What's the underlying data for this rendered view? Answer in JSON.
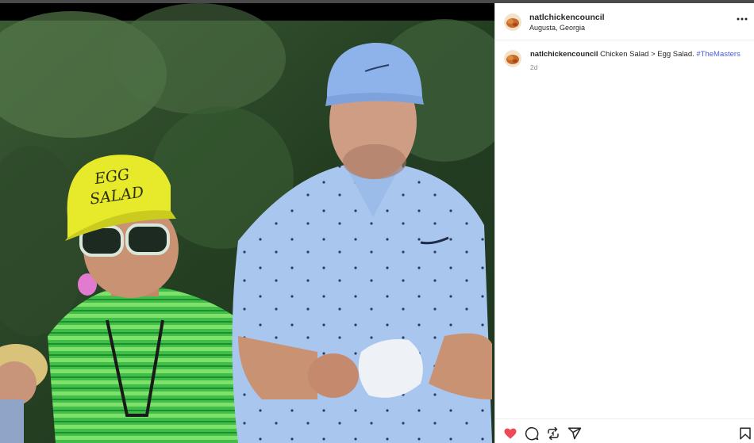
{
  "post": {
    "username": "natlchickencouncil",
    "location": "Augusta, Georgia"
  },
  "media": {
    "cap_text_line1": "EGG",
    "cap_text_line2": "SALAD"
  },
  "caption": {
    "username": "natlchickencouncil",
    "text": "Chicken Salad > Egg Salad.",
    "hashtag": "#TheMasters",
    "time": "2d"
  },
  "icons": {
    "more": "more-options-icon",
    "like": "heart-icon",
    "comment": "comment-icon",
    "repost": "repost-icon",
    "share": "send-icon",
    "save": "bookmark-icon"
  },
  "colors": {
    "like_active": "#ed4956",
    "hashtag": "#4a5fd6",
    "text": "#262626",
    "muted": "#8e8e8e"
  },
  "state": {
    "liked": true
  }
}
